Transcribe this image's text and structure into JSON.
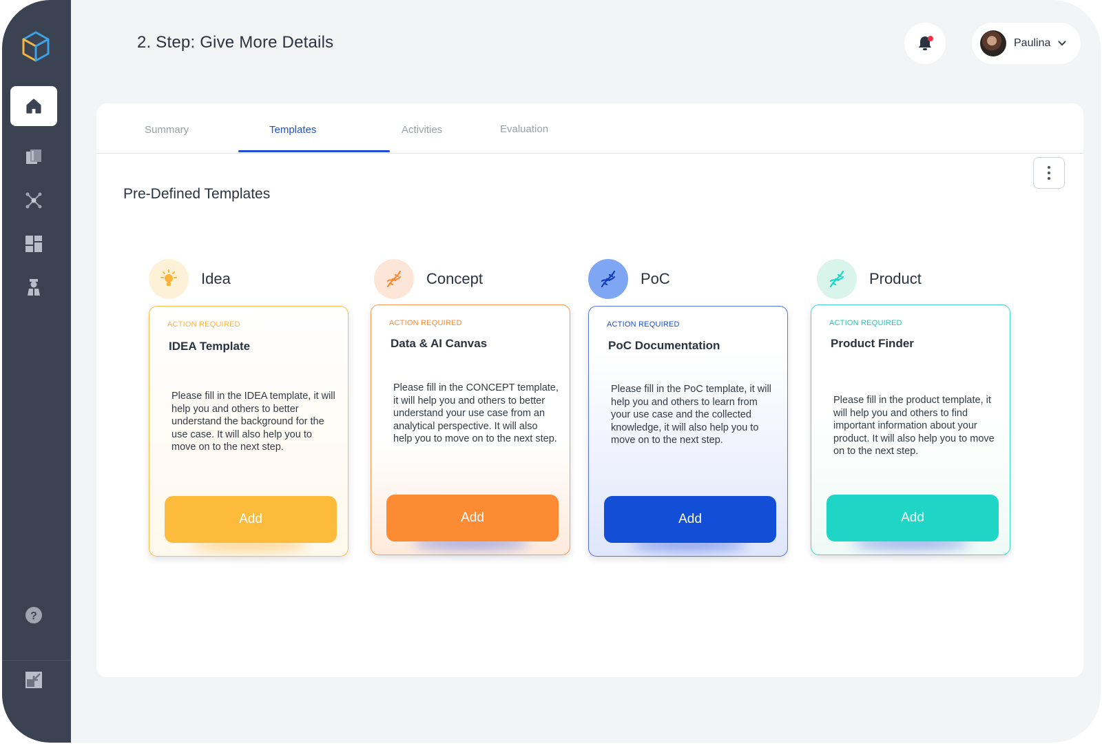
{
  "header": {
    "title": "2. Step: Give More Details",
    "user_name": "Paulina"
  },
  "sidebar": {
    "items": [
      {
        "icon": "home-icon",
        "active": true
      },
      {
        "icon": "documents-icon",
        "active": false
      },
      {
        "icon": "network-icon",
        "active": false
      },
      {
        "icon": "dashboard-icon",
        "active": false
      },
      {
        "icon": "user-icon",
        "active": false
      },
      {
        "icon": "help-icon",
        "active": false
      },
      {
        "icon": "collapse-icon",
        "active": false
      }
    ]
  },
  "tabs": [
    {
      "label": "Summary"
    },
    {
      "label": "Templates",
      "active": true
    },
    {
      "label": "Activities"
    },
    {
      "label": "Evaluation"
    }
  ],
  "section_title": "Pre-Defined Templates",
  "stages": [
    {
      "name": "Idea",
      "icon": "lightbulb-icon",
      "color": "#fbb33a",
      "status": "ACTION REQUIRED",
      "card_title": "IDEA Template",
      "description": "Please fill in the IDEA template, it will help you and others to better understand the background for the use case. It will also help you to move on to the next step.",
      "button": "Add"
    },
    {
      "name": "Concept",
      "icon": "dna-icon",
      "color": "#fb8a30",
      "status": "ACTION REQUIRED",
      "card_title": "Data & AI Canvas",
      "description": "Please fill in the CONCEPT template, it will help you and others to better understand your use case from an analytical perspective. It will also help you to move on to the next step.",
      "button": "Add"
    },
    {
      "name": "PoC",
      "icon": "dna-icon",
      "color": "#124fd6",
      "status": "ACTION REQUIRED",
      "card_title": "PoC Documentation",
      "description": "Please fill in the PoC template, it will help you and others to learn from your use case and the collected knowledge, it will also help you to move on to the next step.",
      "button": "Add"
    },
    {
      "name": "Product",
      "icon": "dna-icon",
      "color": "#1fd6c6",
      "status": "ACTION REQUIRED",
      "card_title": "Product Finder",
      "description": "Please fill in the product template, it will help you and others to find important information about your product. It will also help you to move on to the next step.",
      "button": "Add"
    }
  ]
}
